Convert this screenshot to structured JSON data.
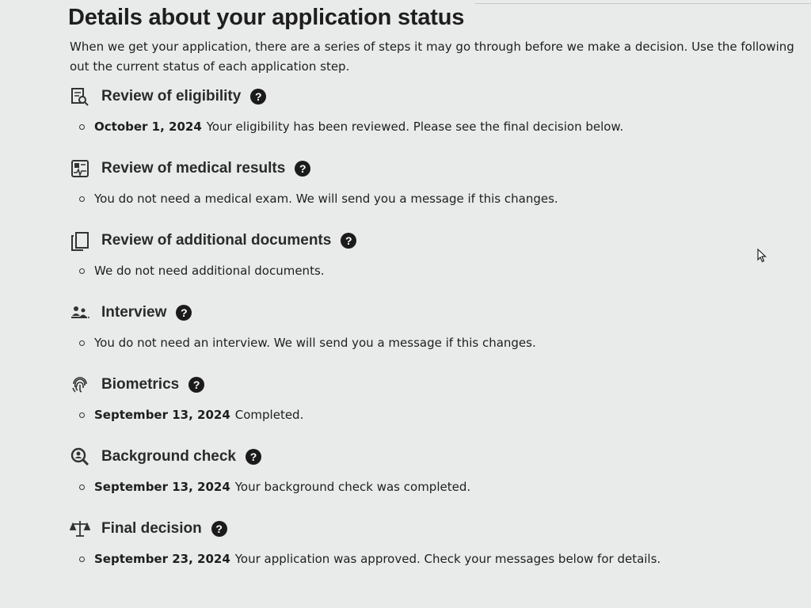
{
  "page": {
    "title": "Details about your application status",
    "intro_line1": "When we get your application, there are a series of steps it may go through before we make a decision. Use the following",
    "intro_line2": "out the current status of each application step."
  },
  "steps": [
    {
      "title": "Review of eligibility",
      "icon": "eligibility-review-icon",
      "date": "October 1, 2024",
      "text": "Your eligibility has been reviewed. Please see the final decision below."
    },
    {
      "title": "Review of medical results",
      "icon": "medical-results-icon",
      "date": "",
      "text": "You do not need a medical exam. We will send you a message if this changes."
    },
    {
      "title": "Review of additional documents",
      "icon": "documents-icon",
      "date": "",
      "text": "We do not need additional documents."
    },
    {
      "title": "Interview",
      "icon": "interview-icon",
      "date": "",
      "text": "You do not need an interview. We will send you a message if this changes."
    },
    {
      "title": "Biometrics",
      "icon": "fingerprint-icon",
      "date": "September 13, 2024",
      "text": "Completed."
    },
    {
      "title": "Background check",
      "icon": "background-check-icon",
      "date": "September 13, 2024",
      "text": "Your background check was completed."
    },
    {
      "title": "Final decision",
      "icon": "scales-icon",
      "date": "September 23, 2024",
      "text": "Your application was approved. Check your messages below for details."
    }
  ],
  "help_glyph": "?",
  "colors": {
    "background": "#e9ebea",
    "text": "#1e1e1e",
    "help_badge": "#1b1b1b"
  }
}
